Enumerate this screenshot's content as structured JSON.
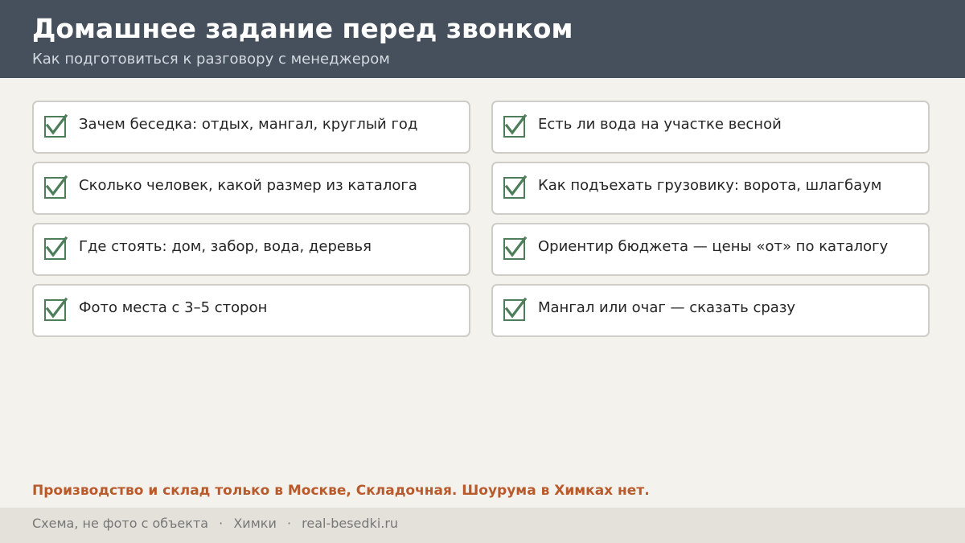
{
  "header": {
    "title": "Домашнее задание перед звонком",
    "subtitle": "Как подготовиться к разговору с менеджером"
  },
  "checklist": {
    "items": [
      {
        "text": "Зачем беседка: отдых, мангал, круглый год",
        "checked": true
      },
      {
        "text": "Есть ли вода на участке весной",
        "checked": true
      },
      {
        "text": "Сколько человек, какой размер из каталога",
        "checked": true
      },
      {
        "text": "Как подъехать грузовику: ворота, шлагбаум",
        "checked": true
      },
      {
        "text": "Где стоять: дом, забор, вода, деревья",
        "checked": true
      },
      {
        "text": "Ориентир бюджета — цены «от» по каталогу",
        "checked": true
      },
      {
        "text": "Фото места с 3–5 сторон",
        "checked": true
      },
      {
        "text": "Мангал или очаг — сказать сразу",
        "checked": true
      }
    ]
  },
  "notice": "Производство и склад только в Москве, Складочная. Шоурума в Химках нет.",
  "footer": {
    "note": "Схема, не фото с объекта",
    "separator": "·",
    "city": "Химки",
    "site": "real-besedki.ru"
  },
  "colors": {
    "header_bg": "#46505c",
    "page_bg": "#f4f2ed",
    "check_green": "#4e7d59",
    "notice_orange": "#b95a2c",
    "footer_bg": "#e4e1da"
  },
  "icons": {
    "checkbox": "checkbox-checked-icon"
  }
}
